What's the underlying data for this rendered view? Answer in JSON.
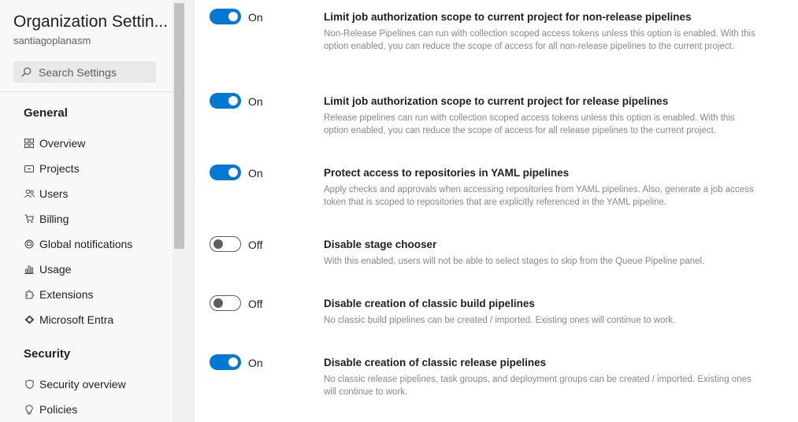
{
  "sidebar": {
    "org_title": "Organization Settin...",
    "org_name": "santiagoplanasm",
    "search_placeholder": "Search Settings",
    "sections": [
      {
        "heading": "General",
        "items": [
          {
            "label": "Overview",
            "icon": "overview-icon"
          },
          {
            "label": "Projects",
            "icon": "projects-icon"
          },
          {
            "label": "Users",
            "icon": "users-icon"
          },
          {
            "label": "Billing",
            "icon": "billing-cart-icon"
          },
          {
            "label": "Global notifications",
            "icon": "notifications-icon"
          },
          {
            "label": "Usage",
            "icon": "usage-chart-icon"
          },
          {
            "label": "Extensions",
            "icon": "extensions-icon"
          },
          {
            "label": "Microsoft Entra",
            "icon": "entra-diamond-icon"
          }
        ]
      },
      {
        "heading": "Security",
        "items": [
          {
            "label": "Security overview",
            "icon": "shield-icon"
          },
          {
            "label": "Policies",
            "icon": "policies-lightbulb-icon"
          }
        ]
      }
    ]
  },
  "settings": [
    {
      "state": "On",
      "enabled": true,
      "title": "Limit job authorization scope to current project for non-release pipelines",
      "description": "Non-Release Pipelines can run with collection scoped access tokens unless this option is enabled. With this option enabled, you can reduce the scope of access for all non-release pipelines to the current project."
    },
    {
      "state": "On",
      "enabled": true,
      "title": "Limit job authorization scope to current project for release pipelines",
      "description": "Release pipelines can run with collection scoped access tokens unless this option is enabled. With this option enabled, you can reduce the scope of access for all release pipelines to the current project."
    },
    {
      "state": "On",
      "enabled": true,
      "title": "Protect access to repositories in YAML pipelines",
      "description": "Apply checks and approvals when accessing repositories from YAML pipelines. Also, generate a job access token that is scoped to repositories that are explicitly referenced in the YAML pipeline."
    },
    {
      "state": "Off",
      "enabled": false,
      "title": "Disable stage chooser",
      "description": "With this enabled, users will not be able to select stages to skip from the Queue Pipeline panel."
    },
    {
      "state": "Off",
      "enabled": false,
      "title": "Disable creation of classic build pipelines",
      "description": "No classic build pipelines can be created / imported. Existing ones will continue to work."
    },
    {
      "state": "On",
      "enabled": true,
      "title": "Disable creation of classic release pipelines",
      "description": "No classic release pipelines, task groups, and deployment groups can be created / imported. Existing ones will continue to work."
    }
  ],
  "colors": {
    "toggle_on": "#0078d4",
    "sidebar_bg": "#f8f8f8",
    "description_text": "#8a8886"
  }
}
